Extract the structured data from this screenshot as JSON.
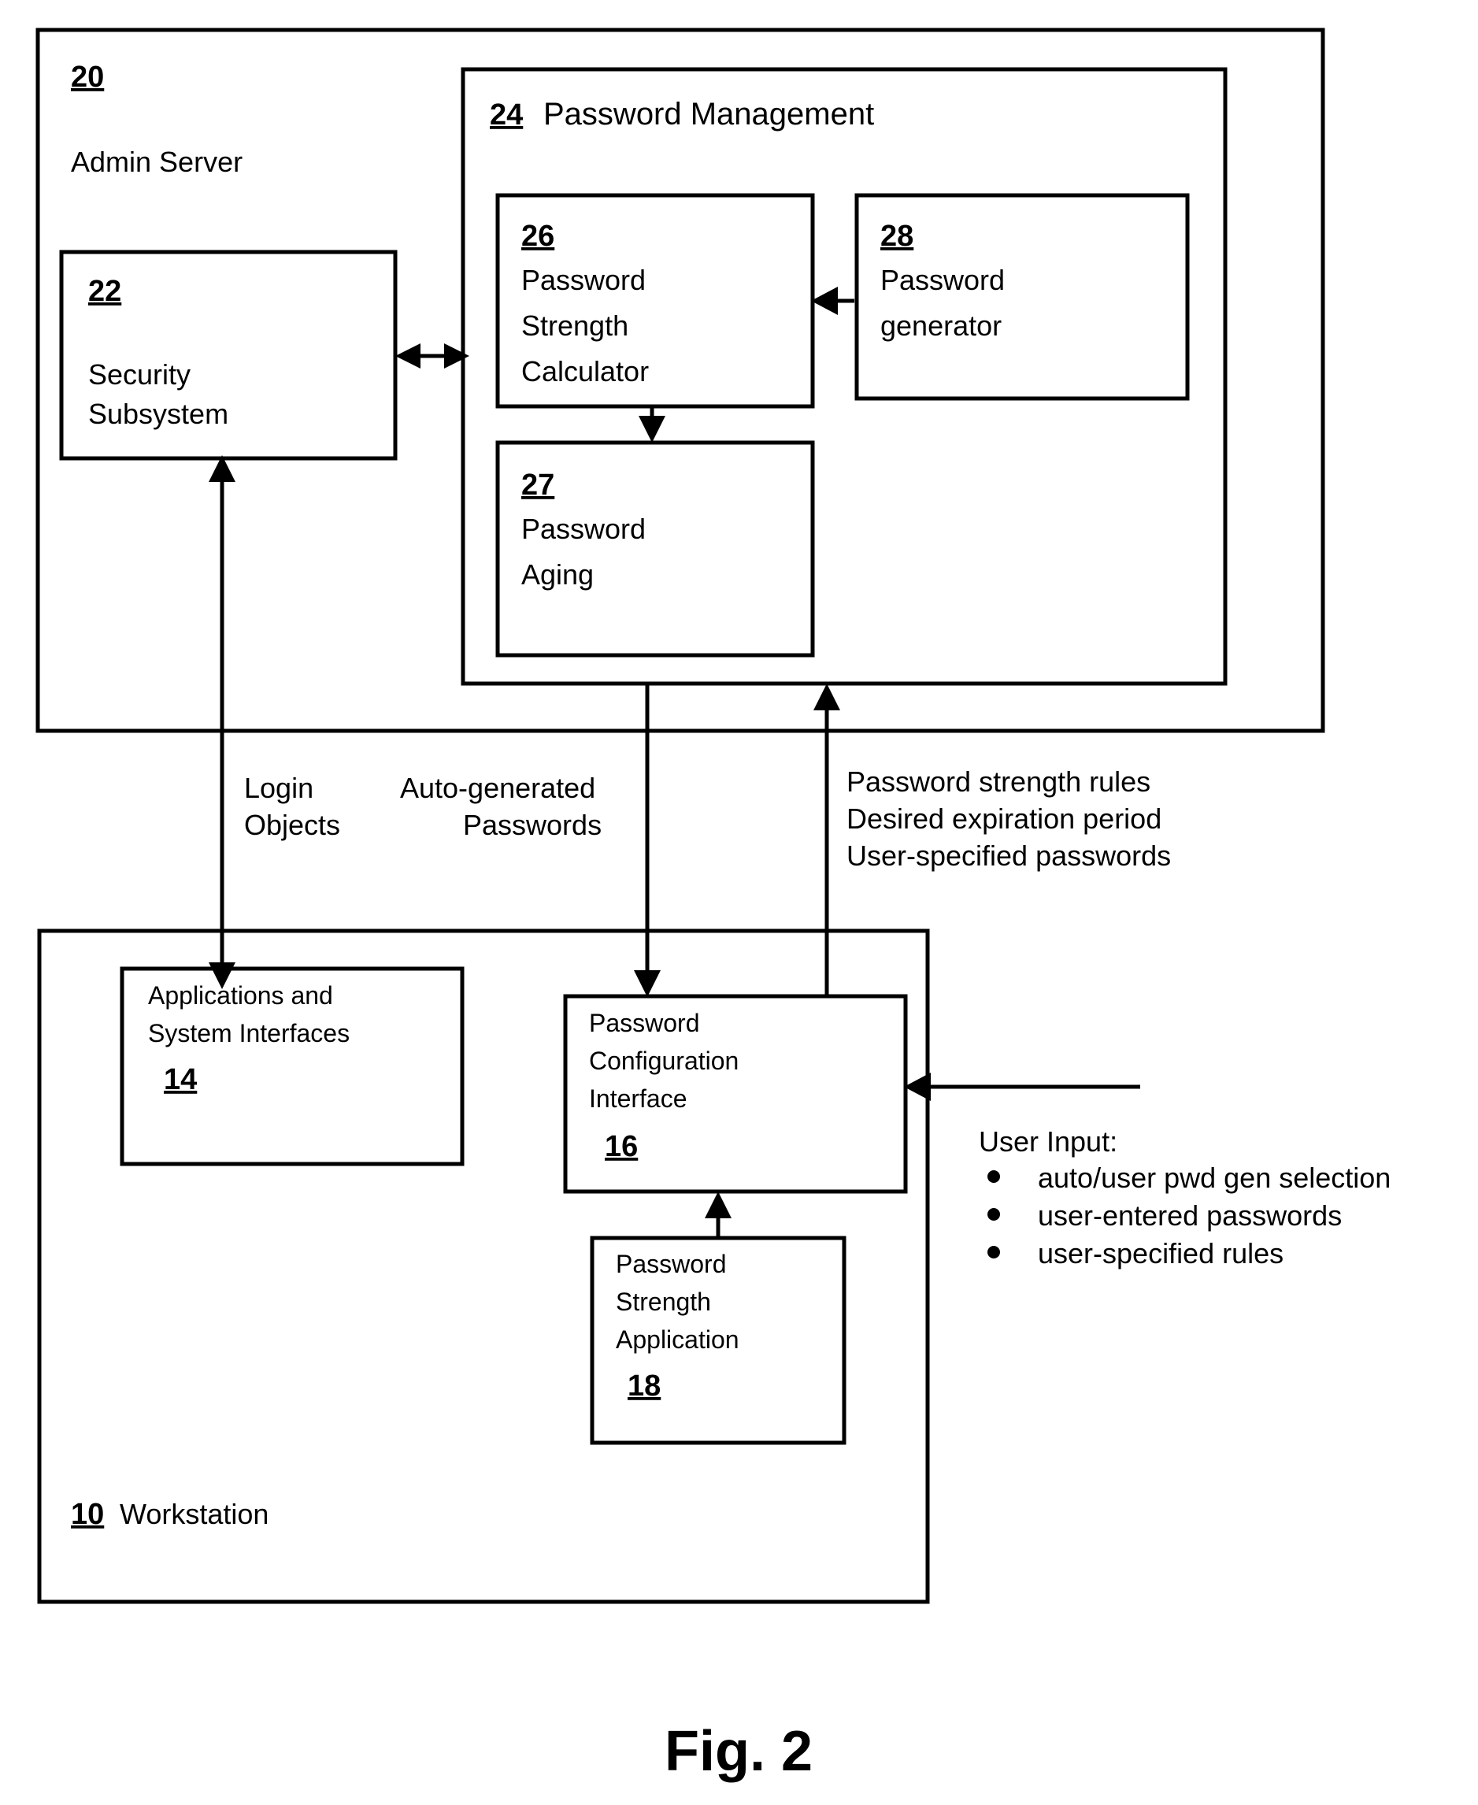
{
  "figure": {
    "caption": "Fig. 2"
  },
  "admin_server": {
    "ref": "20",
    "label": "Admin Server"
  },
  "security_subsystem": {
    "ref": "22",
    "line1": "Security",
    "line2": "Subsystem"
  },
  "password_management": {
    "ref": "24",
    "label": "Password Management"
  },
  "password_strength_calculator": {
    "ref": "26",
    "line1": "Password",
    "line2": "Strength",
    "line3": "Calculator"
  },
  "password_generator": {
    "ref": "28",
    "line1": "Password",
    "line2": "generator"
  },
  "password_aging": {
    "ref": "27",
    "line1": "Password",
    "line2": "Aging"
  },
  "workstation": {
    "ref": "10",
    "label": "Workstation"
  },
  "applications_and_system_interfaces": {
    "line1": "Applications and",
    "line2": "System Interfaces",
    "ref": "14"
  },
  "password_configuration_interface": {
    "line1": "Password",
    "line2": "Configuration",
    "line3": "Interface",
    "ref": "16"
  },
  "password_strength_application": {
    "line1": "Password",
    "line2": "Strength",
    "line3": "Application",
    "ref": "18"
  },
  "flow_labels": {
    "login_objects": {
      "line1": "Login",
      "line2": "Objects"
    },
    "auto_generated_passwords": {
      "line1": "Auto-generated",
      "line2": "Passwords"
    },
    "rules_up": {
      "line1": "Password strength rules",
      "line2": "Desired expiration period",
      "line3": "User-specified passwords"
    }
  },
  "user_input": {
    "heading": "User Input:",
    "items": [
      "auto/user pwd gen selection",
      "user-entered passwords",
      "user-specified rules"
    ]
  },
  "colors": {
    "line": "#000000",
    "background": "#ffffff"
  }
}
